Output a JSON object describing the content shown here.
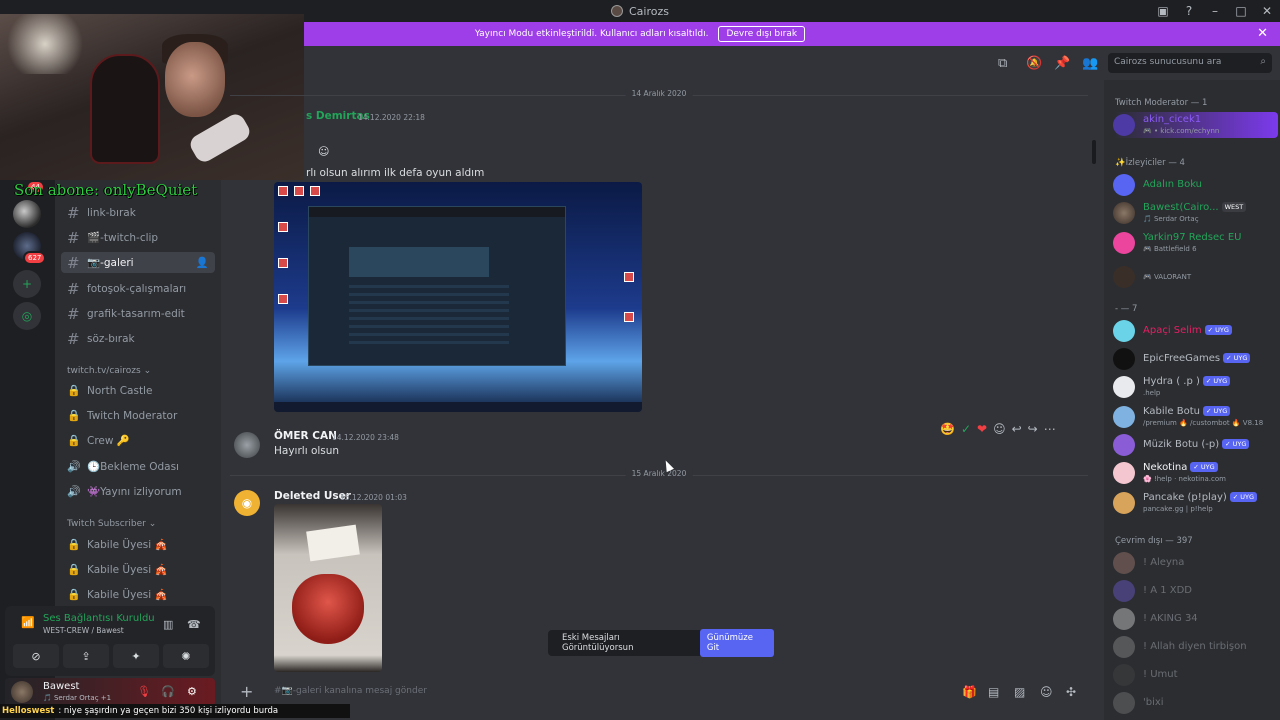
{
  "window": {
    "title": "Cairozs"
  },
  "banner": {
    "text": "Yayıncı Modu etkinleştirildi. Kullanıcı adları kısaltıldı.",
    "button": "Devre dışı bırak",
    "color": "#9d3ee8"
  },
  "overlay": {
    "subtext": "Son abone: onlyBeQuiet"
  },
  "servers": {
    "badge1": "44",
    "badge2": "627"
  },
  "channels": {
    "items": [
      {
        "icon": "hash",
        "label": "link-bırak"
      },
      {
        "icon": "hash",
        "label": "🎬-twitch-clip"
      },
      {
        "icon": "hash",
        "label": "📷-galeri",
        "active": true
      },
      {
        "icon": "hash",
        "label": "fotoşok-çalışmaları"
      },
      {
        "icon": "hash",
        "label": "grafik-tasarım-edit"
      },
      {
        "icon": "hash",
        "label": "söz-bırak"
      }
    ],
    "category1": "twitch.tv/cairozs ⌄",
    "cat1_items": [
      {
        "icon": "lock",
        "label": "North Castle"
      },
      {
        "icon": "lock",
        "label": "Twitch Moderator"
      },
      {
        "icon": "lock",
        "label": "Crew 🔑"
      },
      {
        "icon": "speaker",
        "label": "🕒Bekleme Odası"
      },
      {
        "icon": "speaker",
        "label": "👾Yayını izliyorum"
      }
    ],
    "category2": "Twitch Subscriber ⌄",
    "cat2_items": [
      {
        "icon": "lock",
        "label": "Kabile Üyesi 🎪"
      },
      {
        "icon": "lock",
        "label": "Kabile Üyesi 🎪"
      },
      {
        "icon": "lock",
        "label": "Kabile Üyesi 🎪"
      }
    ]
  },
  "voice": {
    "status": "Ses Bağlantısı Kuruldu",
    "sub": "WEST-CREW / Bawest"
  },
  "user": {
    "name": "Bawest",
    "sub": "🎵 Serdar Ortaç +1"
  },
  "ticker": {
    "user": "Helloswest",
    "text": ": niye şaşırdın ya geçen bizi 350 kişi izliyordu burda"
  },
  "chat": {
    "date1": "14 Aralık 2020",
    "msg1": {
      "author": "s Demirtas",
      "time": "14.12.2020 22:18",
      "text": "rlı olsun alırım ilk defa oyun aldım"
    },
    "msg2": {
      "author": "ÖMER CAN",
      "time": "14.12.2020 23:48",
      "text": "Hayırlı olsun"
    },
    "date2": "15 Aralık 2020",
    "msg3": {
      "author": "Deleted User",
      "time": "15.12.2020 01:03"
    },
    "jump": {
      "text": "Eski Mesajları Görüntülüyorsun",
      "button": "Günümüze Git"
    },
    "composer_placeholder": "#📷-galeri kanalına mesaj gönder"
  },
  "search": {
    "placeholder": "Cairozs sunucusunu ara"
  },
  "members": {
    "group1": "Twitch Moderator — 1",
    "group2": "✨İzleyiciler — 4",
    "group3": "- — 7",
    "group4": "Çevrim dışı — 397",
    "list": [
      {
        "name": "akin_cicek1",
        "sub": "🎮 • kick.com/echynn",
        "color": "#8b5cf6"
      },
      {
        "name": "Adalın Boku",
        "sub": "",
        "color": "#23a559"
      },
      {
        "name": "Bawest(Cairo...",
        "sub": "🎵 Serdar Ortaç",
        "color": "#23a559",
        "extra": "WEST"
      },
      {
        "name": "Yarkin97 Redsec EU",
        "sub": "🎮 Battlefield 6",
        "color": "#23a559"
      },
      {
        "name": "",
        "sub": "🎮 VALORANT",
        "color": "#23a559"
      },
      {
        "name": "Apaçi Selim",
        "sub": "",
        "color": "#e91e63",
        "tag": "✓ UYG"
      },
      {
        "name": "EpicFreeGames",
        "sub": "",
        "color": "#b5bac1",
        "tag": "✓ UYG"
      },
      {
        "name": "Hydra ( .p )",
        "sub": ".help",
        "color": "#b5bac1",
        "tag": "✓ UYG"
      },
      {
        "name": "Kabile Botu",
        "sub": "/premium 🔥 /custombot 🔥 V8.18",
        "color": "#b5bac1",
        "tag": "✓ UYG"
      },
      {
        "name": "Müzik Botu (-p)",
        "sub": "",
        "color": "#b5bac1",
        "tag": "✓ UYG"
      },
      {
        "name": "Nekotina",
        "sub": "🌸 !help · nekotina.com",
        "color": "#f2f3f5",
        "tag": "✓ UYG"
      },
      {
        "name": "Pancake (p!play)",
        "sub": "pancake.gg | p!help",
        "color": "#b5bac1",
        "tag": "✓ UYG"
      },
      {
        "name": "! Aleyna",
        "sub": "",
        "color": "#b5bac1"
      },
      {
        "name": "! A 1 XDD",
        "sub": "",
        "color": "#b5bac1"
      },
      {
        "name": "! AKING 34",
        "sub": "",
        "color": "#b5bac1"
      },
      {
        "name": "! Allah diyen tirbişon",
        "sub": "",
        "color": "#b5bac1"
      },
      {
        "name": "! Umut",
        "sub": "",
        "color": "#b5bac1"
      },
      {
        "name": "'bixi",
        "sub": "",
        "color": "#b5bac1"
      }
    ]
  }
}
